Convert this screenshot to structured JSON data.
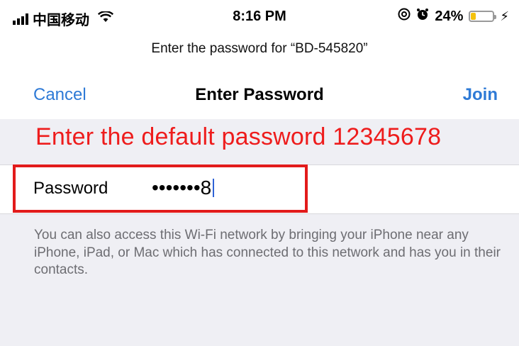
{
  "status_bar": {
    "carrier": "中国移动",
    "time": "8:16 PM",
    "battery_percent": "24%",
    "battery_level": 0.24,
    "icons": [
      "signal-icon",
      "wifi-icon",
      "at-icon",
      "alarm-icon",
      "battery-icon",
      "charging-bolt-icon"
    ]
  },
  "prompt": "Enter the password for “BD-545820”",
  "nav": {
    "cancel_label": "Cancel",
    "title": "Enter Password",
    "join_label": "Join"
  },
  "instruction": "Enter the default password 12345678",
  "password_field": {
    "label": "Password",
    "value": "•••••••8"
  },
  "help_text": "You can also access this Wi-Fi network by bringing your iPhone near any iPhone, iPad, or Mac which has connected to this network and has you in their contacts.",
  "colors": {
    "accent": "#2e7ad6",
    "annotation_red": "#ee1c1c",
    "background": "#efeff4"
  }
}
